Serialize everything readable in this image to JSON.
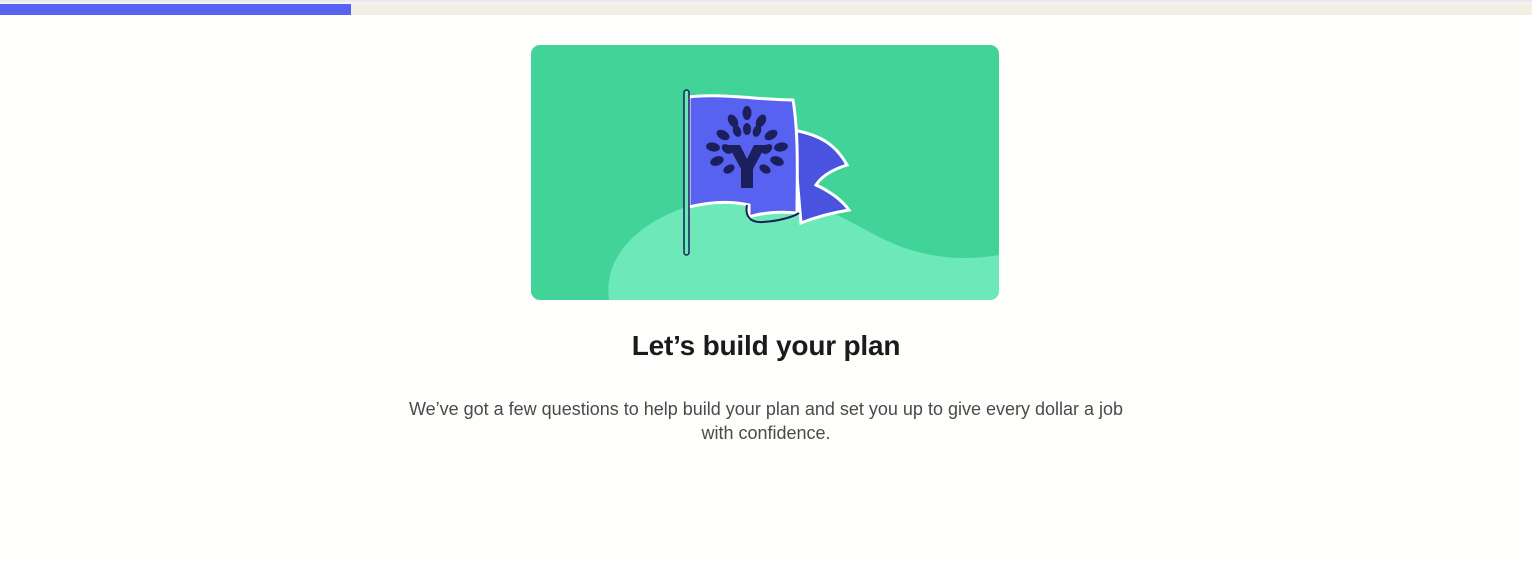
{
  "progress": {
    "value": 0.229,
    "fill_color": "#5762f0",
    "track_color": "#f3efe4"
  },
  "hero": {
    "icon": "flag-with-tree-logo-illustration",
    "background_color": "#42d398",
    "hill_color": "#6de8b8",
    "flag_color": "#5762f0"
  },
  "onboarding": {
    "title": "Let’s build your plan",
    "description": "We’ve got a few questions to help build your plan and set you up to give every dollar a job with confidence."
  }
}
